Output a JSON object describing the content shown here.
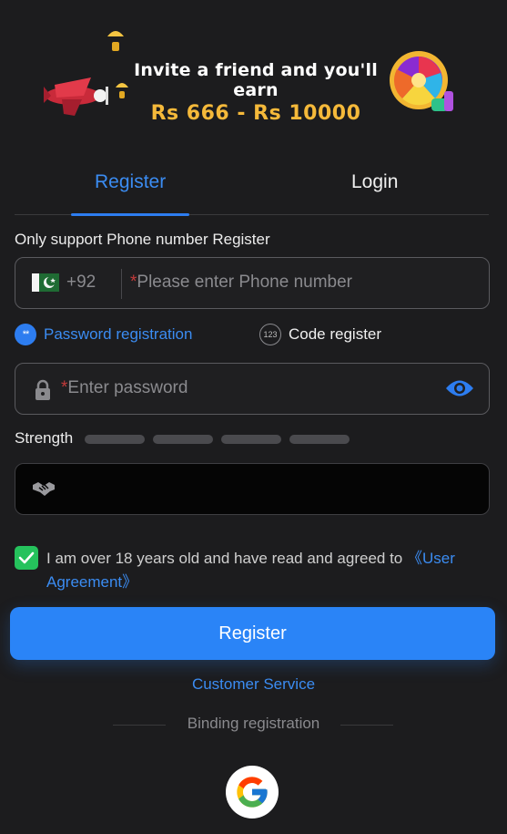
{
  "banner": {
    "line1": "Invite a friend and you'll earn",
    "line2": "Rs 666 - Rs 10000"
  },
  "tabs": [
    {
      "label": "Register",
      "active": true
    },
    {
      "label": "Login",
      "active": false
    }
  ],
  "phone": {
    "hint": "Only support Phone number Register",
    "country_code": "+92",
    "required_mark": "*",
    "placeholder": "Please enter Phone number"
  },
  "modes": {
    "password_label": "Password registration",
    "password_badge": "**",
    "code_label": "Code register",
    "code_badge": "123"
  },
  "password": {
    "required_mark": "*",
    "placeholder": "Enter password"
  },
  "strength": {
    "label": "Strength",
    "levels": 4
  },
  "agreement": {
    "text": "I am over 18 years old and have read and agreed to ",
    "link": "《User Agreement》",
    "checked": true
  },
  "register_button": "Register",
  "customer_service": "Customer Service",
  "binding": "Binding registration",
  "colors": {
    "accent": "#2a84f7",
    "link": "#3b8cf2",
    "check": "#25c25c",
    "gold": "#f5b93a",
    "background": "#1c1c1e"
  },
  "icons": [
    "pakistan-flag-icon",
    "lock-icon",
    "eye-icon",
    "handshake-icon",
    "check-icon",
    "google-icon"
  ]
}
